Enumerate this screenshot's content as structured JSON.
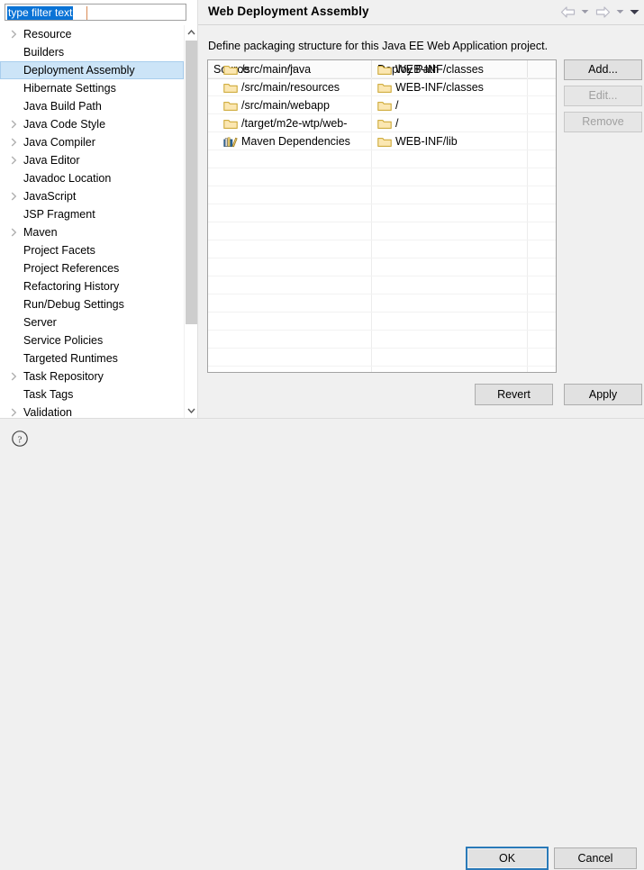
{
  "filter": {
    "value": "type filter text",
    "placeholder": "type filter text"
  },
  "tree": {
    "items": [
      {
        "label": "Resource",
        "expandable": true,
        "selected": false
      },
      {
        "label": "Builders",
        "expandable": false,
        "selected": false
      },
      {
        "label": "Deployment Assembly",
        "expandable": false,
        "selected": true
      },
      {
        "label": "Hibernate Settings",
        "expandable": false,
        "selected": false
      },
      {
        "label": "Java Build Path",
        "expandable": false,
        "selected": false
      },
      {
        "label": "Java Code Style",
        "expandable": true,
        "selected": false
      },
      {
        "label": "Java Compiler",
        "expandable": true,
        "selected": false
      },
      {
        "label": "Java Editor",
        "expandable": true,
        "selected": false
      },
      {
        "label": "Javadoc Location",
        "expandable": false,
        "selected": false
      },
      {
        "label": "JavaScript",
        "expandable": true,
        "selected": false
      },
      {
        "label": "JSP Fragment",
        "expandable": false,
        "selected": false
      },
      {
        "label": "Maven",
        "expandable": true,
        "selected": false
      },
      {
        "label": "Project Facets",
        "expandable": false,
        "selected": false
      },
      {
        "label": "Project References",
        "expandable": false,
        "selected": false
      },
      {
        "label": "Refactoring History",
        "expandable": false,
        "selected": false
      },
      {
        "label": "Run/Debug Settings",
        "expandable": false,
        "selected": false
      },
      {
        "label": "Server",
        "expandable": false,
        "selected": false
      },
      {
        "label": "Service Policies",
        "expandable": false,
        "selected": false
      },
      {
        "label": "Targeted Runtimes",
        "expandable": false,
        "selected": false
      },
      {
        "label": "Task Repository",
        "expandable": true,
        "selected": false
      },
      {
        "label": "Task Tags",
        "expandable": false,
        "selected": false
      },
      {
        "label": "Validation",
        "expandable": true,
        "selected": false
      }
    ]
  },
  "page": {
    "title": "Web Deployment Assembly",
    "description": "Define packaging structure for this Java EE Web Application project."
  },
  "nav": {
    "back_icon": "back-arrow-icon",
    "back_menu_icon": "chevron-down-icon",
    "forward_icon": "forward-arrow-icon",
    "forward_menu_icon": "chevron-down-icon",
    "menu_icon": "chevron-down-filled-icon"
  },
  "table": {
    "columns": [
      {
        "key": "source",
        "label": "Source",
        "sort": "asc"
      },
      {
        "key": "deploy",
        "label": "Deploy Path",
        "sort": ""
      }
    ],
    "rows": [
      {
        "source": "/src/main/java",
        "source_icon": "folder-icon",
        "deploy": "WEB-INF/classes",
        "deploy_icon": "folder-icon"
      },
      {
        "source": "/src/main/resources",
        "source_icon": "folder-icon",
        "deploy": "WEB-INF/classes",
        "deploy_icon": "folder-icon"
      },
      {
        "source": "/src/main/webapp",
        "source_icon": "folder-icon",
        "deploy": "/",
        "deploy_icon": "folder-icon"
      },
      {
        "source": "/target/m2e-wtp/web-",
        "source_icon": "folder-icon",
        "deploy": "/",
        "deploy_icon": "folder-icon"
      },
      {
        "source": "Maven Dependencies",
        "source_icon": "library-icon",
        "deploy": "WEB-INF/lib",
        "deploy_icon": "folder-icon"
      }
    ],
    "empty_row_count": 12
  },
  "side_buttons": [
    {
      "label": "Add...",
      "enabled": true
    },
    {
      "label": "Edit...",
      "enabled": false
    },
    {
      "label": "Remove",
      "enabled": false
    }
  ],
  "form_buttons": {
    "revert": "Revert",
    "apply": "Apply"
  },
  "dialog_buttons": {
    "help_icon": "help-question-icon",
    "ok": "OK",
    "cancel": "Cancel"
  },
  "colors": {
    "selection_blue": "#cce4f7",
    "text_select_blue": "#0a73d6",
    "focus_border": "#2a7ab8",
    "folder_fill": "#fbe7b2",
    "folder_border": "#c9a227",
    "dialog_bg": "#f0f0f0"
  }
}
